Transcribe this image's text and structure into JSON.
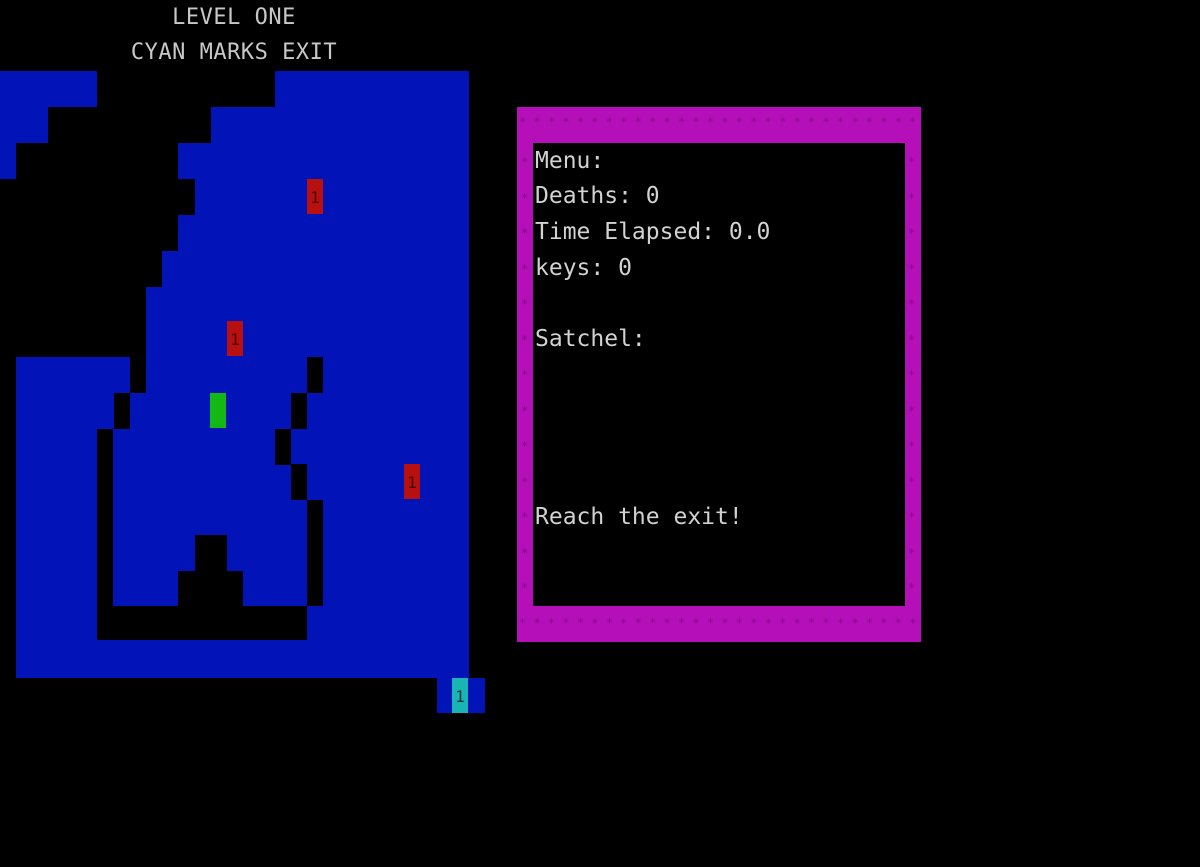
{
  "level": {
    "title": "LEVEL ONE",
    "subtitle": "CYAN MARKS EXIT"
  },
  "map": {
    "water_color": "#0214b8",
    "wall_color": "#000000",
    "player_color": "#14b814",
    "enemy_color": "#b80f0f",
    "exit_color": "#19b5b5",
    "enemy_label": "1",
    "exit_label": "1"
  },
  "panel": {
    "menu_label": "Menu:",
    "deaths_label": "Deaths: 0",
    "time_label": "Time Elapsed: 0.0",
    "keys_label": "keys: 0",
    "satchel_label": "Satchel:",
    "objective": "Reach the exit!",
    "frame_color": "#b40fb8",
    "border_char": "*"
  }
}
